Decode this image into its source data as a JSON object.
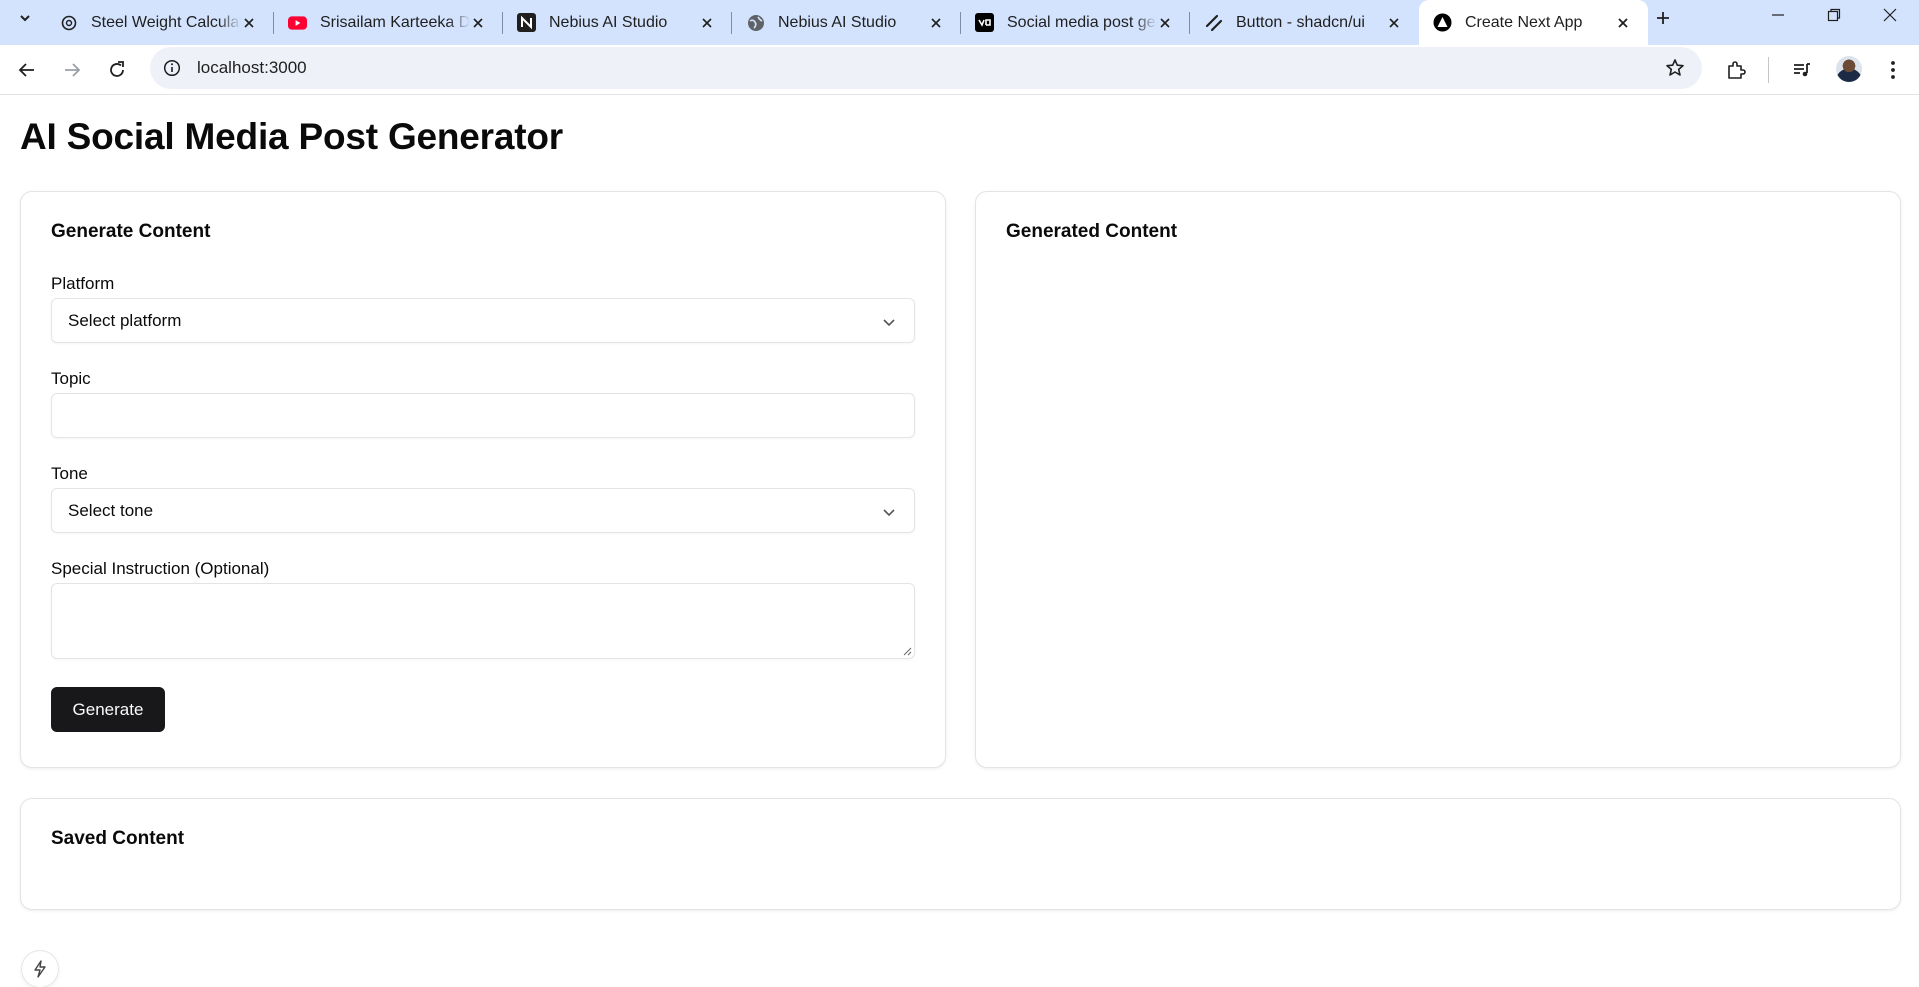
{
  "browser": {
    "tabs": [
      {
        "title": "Steel Weight Calculator",
        "icon": "openai-icon"
      },
      {
        "title": "Srisailam Karteeka Deepotsavam",
        "icon": "youtube-icon"
      },
      {
        "title": "Nebius AI Studio",
        "icon": "nebius-icon"
      },
      {
        "title": "Nebius AI Studio",
        "icon": "globe-icon"
      },
      {
        "title": "Social media post generator",
        "icon": "v0-icon"
      },
      {
        "title": "Button - shadcn/ui",
        "icon": "shadcn-icon"
      },
      {
        "title": "Create Next App",
        "icon": "nextjs-icon",
        "active": true
      }
    ],
    "address": "localhost:3000"
  },
  "page": {
    "title": "AI Social Media Post Generator"
  },
  "generate_card": {
    "title": "Generate Content",
    "platform_label": "Platform",
    "platform_placeholder": "Select platform",
    "topic_label": "Topic",
    "topic_value": "",
    "tone_label": "Tone",
    "tone_placeholder": "Select tone",
    "instruction_label": "Special Instruction (Optional)",
    "instruction_value": "",
    "generate_button": "Generate"
  },
  "generated_card": {
    "title": "Generated Content"
  },
  "saved_card": {
    "title": "Saved Content"
  },
  "colors": {
    "tabbar_bg": "#d3e3fd",
    "primary_button": "#18181b",
    "border": "#e4e4e7"
  }
}
